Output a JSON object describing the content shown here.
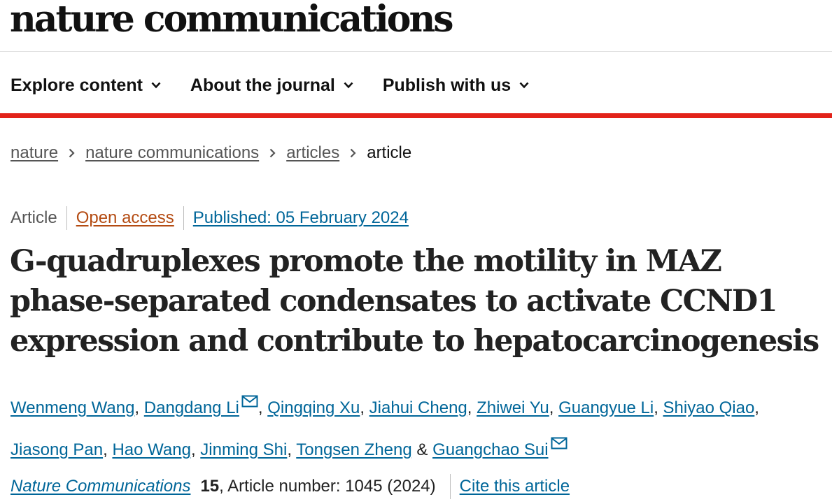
{
  "header": {
    "brand": "nature communications",
    "nav": [
      {
        "label": "Explore content"
      },
      {
        "label": "About the journal"
      },
      {
        "label": "Publish with us"
      }
    ]
  },
  "breadcrumb": {
    "items": [
      "nature",
      "nature communications",
      "articles"
    ],
    "current": "article"
  },
  "article": {
    "type": "Article",
    "access": "Open access",
    "published": "Published: 05 February 2024",
    "title": "G-quadruplexes promote the motility in MAZ phase-separated condensates to activate CCND1 expression and contribute to hepatocarcinogenesis",
    "authors": [
      {
        "name": "Wenmeng Wang",
        "email": false
      },
      {
        "name": "Dangdang Li",
        "email": true
      },
      {
        "name": "Qingqing Xu",
        "email": false
      },
      {
        "name": "Jiahui Cheng",
        "email": false
      },
      {
        "name": "Zhiwei Yu",
        "email": false
      },
      {
        "name": "Guangyue Li",
        "email": false
      },
      {
        "name": "Shiyao Qiao",
        "email": false
      },
      {
        "name": "Jiasong Pan",
        "email": false
      },
      {
        "name": "Hao Wang",
        "email": false
      },
      {
        "name": "Jinming Shi",
        "email": false
      },
      {
        "name": "Tongsen Zheng",
        "email": false
      },
      {
        "name": "Guangchao Sui",
        "email": true
      }
    ],
    "citation": {
      "journal": "Nature Communications",
      "volume": "15",
      "article_number": ", Article number: 1045 (2024)",
      "cite_link": "Cite this article"
    }
  },
  "colors": {
    "accent_red": "#e2231a",
    "link_blue": "#006699",
    "open_access_orange": "#b44b12"
  }
}
